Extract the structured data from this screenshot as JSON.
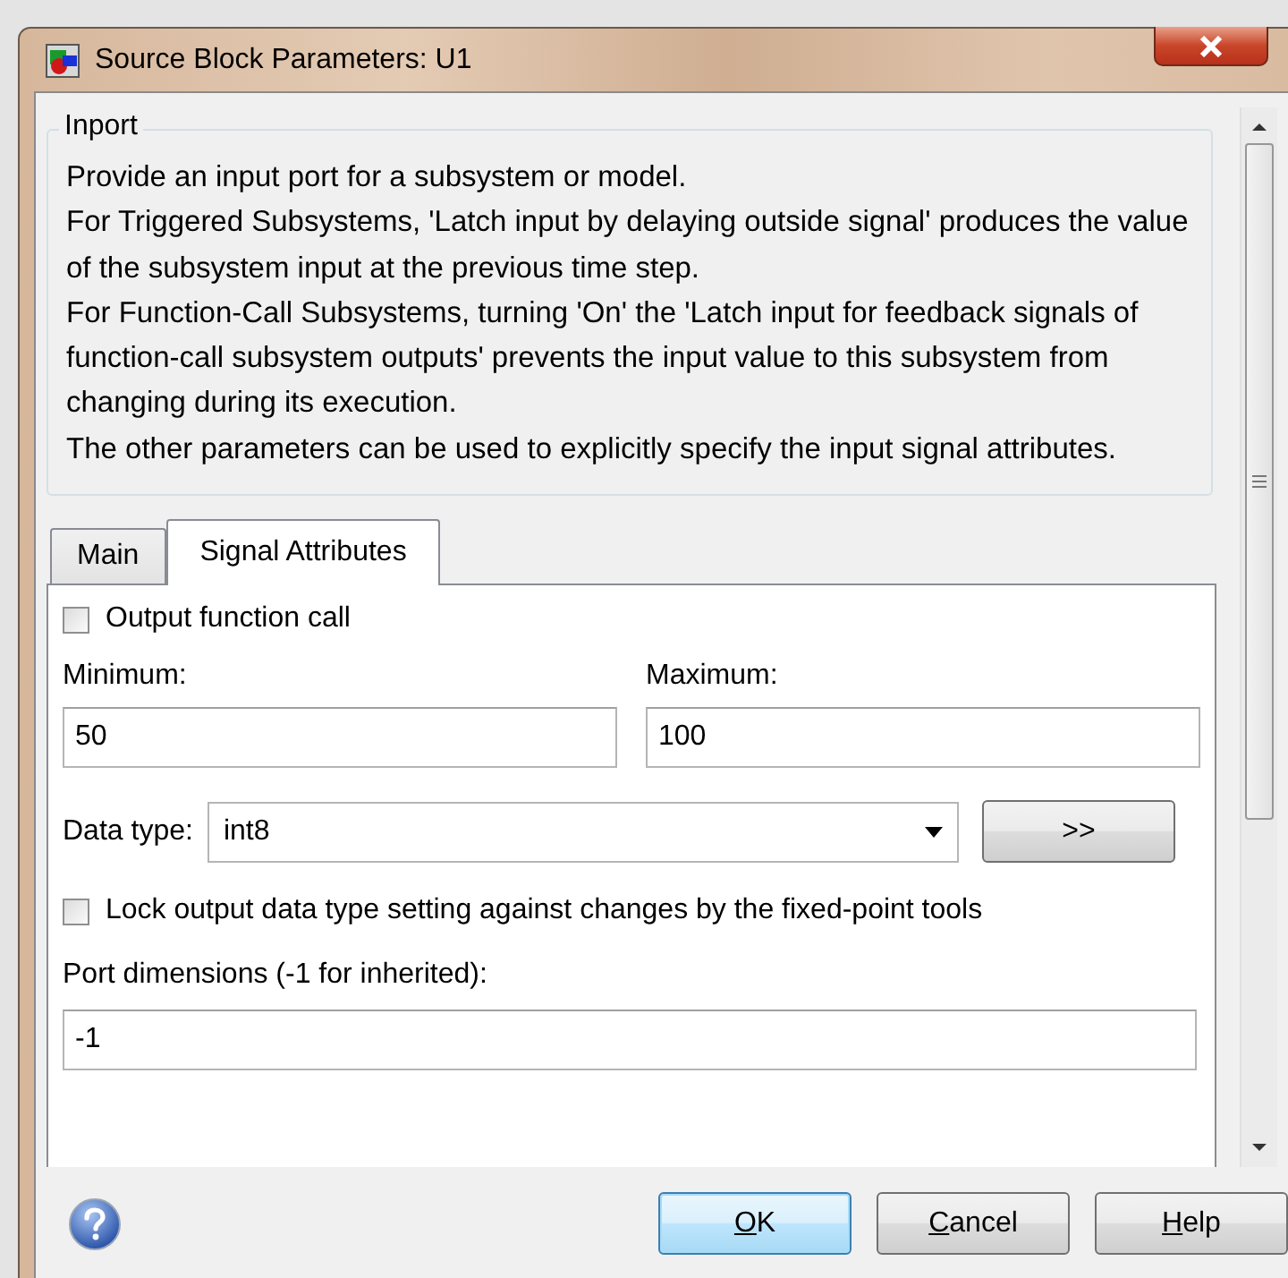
{
  "window": {
    "title": "Source Block Parameters: U1"
  },
  "description": {
    "title": "Inport",
    "paragraphs": [
      "Provide an input port for a subsystem or model.",
      "For Triggered Subsystems, 'Latch input by delaying outside signal' produces the value of the subsystem input at the previous time step.",
      "For Function-Call Subsystems, turning 'On' the 'Latch input for feedback signals of function-call subsystem outputs' prevents the input value to this subsystem from changing during its execution.",
      "The other parameters can be used to explicitly specify the input signal attributes."
    ]
  },
  "tabs": [
    {
      "label": "Main",
      "selected": false
    },
    {
      "label": "Signal Attributes",
      "selected": true
    }
  ],
  "signal_attributes": {
    "output_function_call": {
      "label": "Output function call",
      "checked": false
    },
    "minimum": {
      "label": "Minimum:",
      "value": "50"
    },
    "maximum": {
      "label": "Maximum:",
      "value": "100"
    },
    "data_type": {
      "label": "Data type:",
      "value": "int8"
    },
    "data_type_assistant": {
      "label": ">>"
    },
    "lock_output_data_type": {
      "label": "Lock output data type setting against changes by the fixed-point tools",
      "checked": false
    },
    "port_dimensions": {
      "label": "Port dimensions (-1 for inherited):",
      "value": "-1"
    }
  },
  "buttons": [
    {
      "label": "OK",
      "default": true
    },
    {
      "label": "Cancel",
      "default": false
    },
    {
      "label": "Help",
      "default": false
    }
  ]
}
